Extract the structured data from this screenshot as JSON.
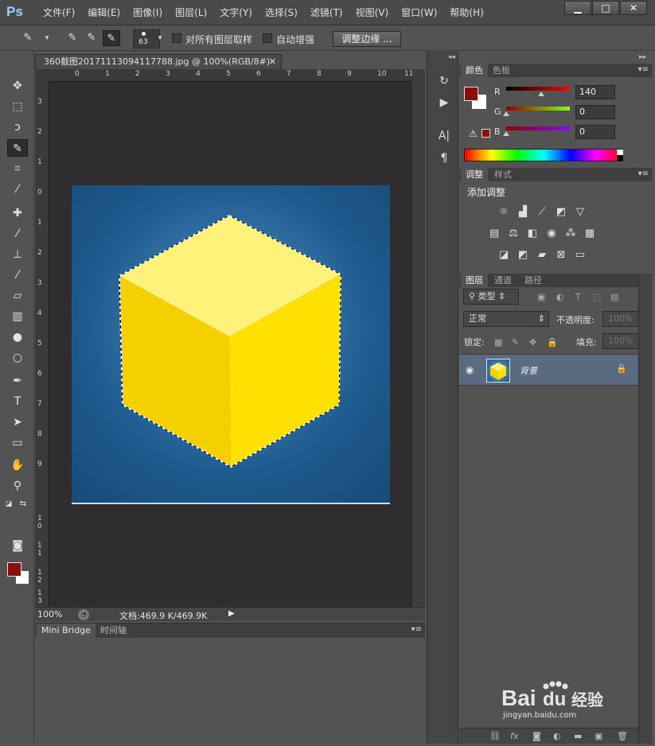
{
  "app": {
    "logo": "Ps"
  },
  "menu": [
    "文件(F)",
    "编辑(E)",
    "图像(I)",
    "图层(L)",
    "文字(Y)",
    "选择(S)",
    "滤镜(T)",
    "视图(V)",
    "窗口(W)",
    "帮助(H)"
  ],
  "window_controls": {
    "minimize": "▁",
    "maximize": "□",
    "close": "✕"
  },
  "options": {
    "brush_size": "63",
    "sample_all_layers_label": "对所有图层取样",
    "auto_enhance_label": "自动增强",
    "refine_edge_label": "调整边缘 ...",
    "sample_all_layers_checked": false,
    "auto_enhance_checked": false
  },
  "document": {
    "tab_title": "360截图20171113094117788.jpg @ 100%(RGB/8#)",
    "tab_close": "✕",
    "ruler_h": [
      "0",
      "1",
      "2",
      "3",
      "4",
      "5",
      "6",
      "7",
      "8",
      "9",
      "10",
      "11"
    ],
    "ruler_v": [
      "3",
      "2",
      "1",
      "0",
      "1",
      "2",
      "3",
      "4",
      "5",
      "6",
      "7",
      "8",
      "9",
      "1\n0",
      "1\n1",
      "1\n2",
      "1\n3"
    ],
    "zoom": "100%",
    "info": "文档:469.9 K/469.9K",
    "artboard_bg": "#1e5b8f",
    "cube": {
      "top": "#fff27a",
      "left": "#f5d000",
      "right": "#ffe100"
    }
  },
  "bottom_panel": {
    "tabs": [
      "Mini Bridge",
      "时间轴"
    ],
    "active": 0
  },
  "colors": {
    "foreground": "#8c0d0d",
    "background": "#ffffff"
  },
  "color_panel": {
    "tabs": [
      "颜色",
      "色板"
    ],
    "channels": [
      {
        "label": "R",
        "value": "140"
      },
      {
        "label": "G",
        "value": "0"
      },
      {
        "label": "B",
        "value": "0"
      }
    ],
    "r_level": 0.549
  },
  "adjustments": {
    "tabs": [
      "调整",
      "样式"
    ],
    "title": "添加调整"
  },
  "layers": {
    "tabs": [
      "图层",
      "通道",
      "路径"
    ],
    "filter_label": "类型",
    "blend_mode": "正常",
    "opacity_label": "不透明度:",
    "opacity_value": "100%",
    "lock_label": "锁定:",
    "fill_label": "填充:",
    "fill_value": "100%",
    "layer_name": "背景"
  },
  "watermark": {
    "brand": "Bai",
    "brand_suffix": "du",
    "service": "经验",
    "url": "jingyan.baidu.com"
  }
}
